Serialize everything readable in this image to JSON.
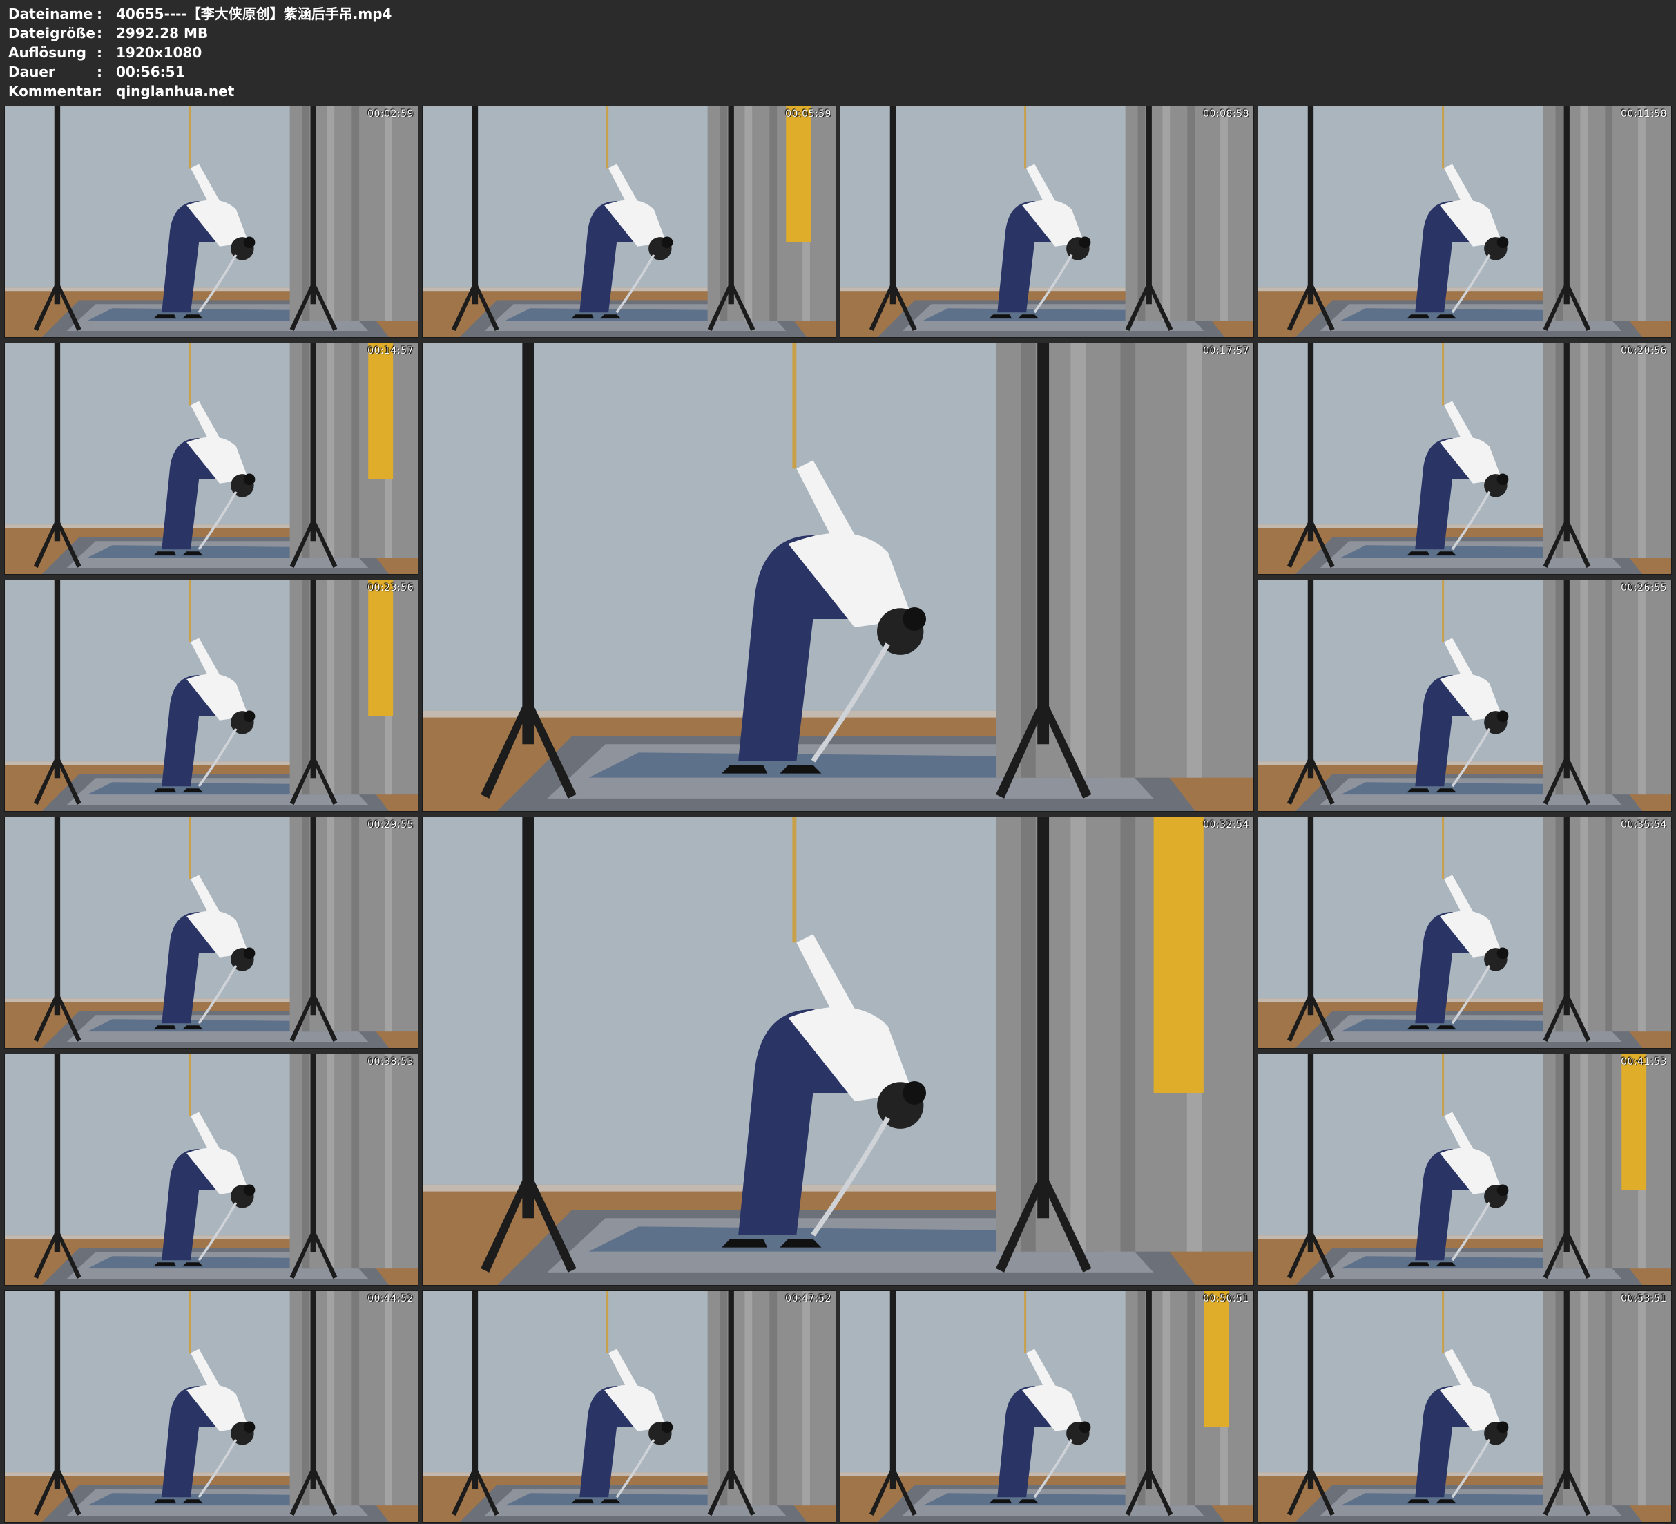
{
  "info": [
    {
      "key": "Dateiname",
      "value": "40655----【李大侠原创】紫涵后手吊.mp4"
    },
    {
      "key": "Dateigröße",
      "value": "2992.28 MB"
    },
    {
      "key": "Auflösung",
      "value": "1920x1080"
    },
    {
      "key": "Dauer",
      "value": "00:56:51"
    },
    {
      "key": "Kommentar",
      "value": "qinglanhua.net"
    }
  ],
  "thumbnails": [
    {
      "timestamp": "00:02:59"
    },
    {
      "timestamp": "00:05:59"
    },
    {
      "timestamp": "00:08:58"
    },
    {
      "timestamp": "00:11:58"
    },
    {
      "timestamp": "00:14:57"
    },
    {
      "timestamp": "00:17:57"
    },
    {
      "timestamp": "00:20:56"
    },
    {
      "timestamp": "00:23:56"
    },
    {
      "timestamp": "00:26:55"
    },
    {
      "timestamp": "00:29:55"
    },
    {
      "timestamp": "00:32:54"
    },
    {
      "timestamp": "00:35:54"
    },
    {
      "timestamp": "00:38:53"
    },
    {
      "timestamp": "00:41:53"
    },
    {
      "timestamp": "00:44:52"
    },
    {
      "timestamp": "00:47:52"
    },
    {
      "timestamp": "00:50:51"
    },
    {
      "timestamp": "00:53:51"
    }
  ],
  "colors": {
    "background": "#2b2b2b",
    "wall": "#aab5be",
    "floor": "#a0754a",
    "pants": "#2a3566",
    "shirt": "#f3f3f3",
    "curtain": "#8e8e8e",
    "rope": "#c9a04a",
    "yellow": "#e0ad2a"
  }
}
